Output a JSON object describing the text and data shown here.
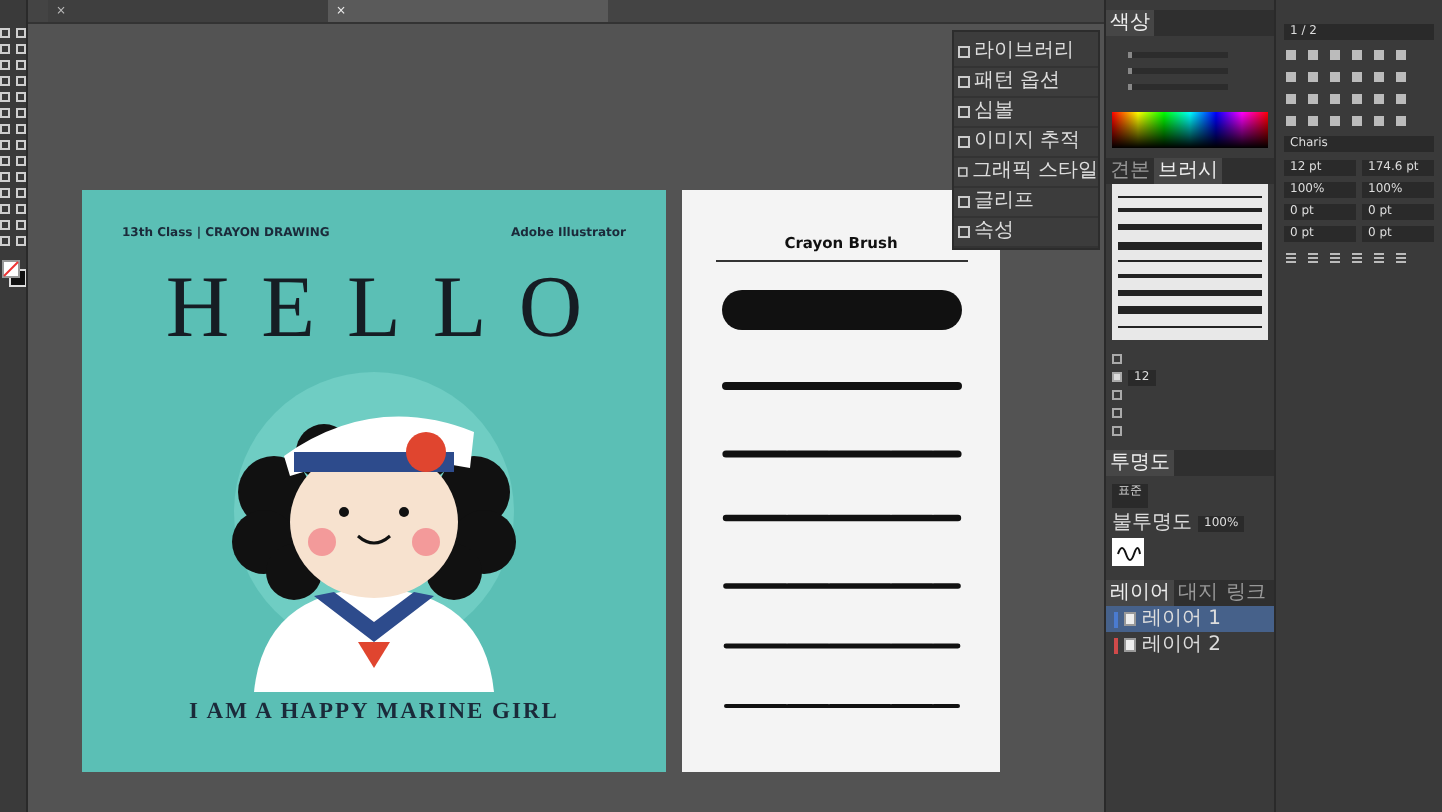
{
  "tabs": [
    {
      "close": "×",
      "selected": false
    },
    {
      "close": "×",
      "selected": true
    }
  ],
  "quick_panel": {
    "items": [
      {
        "label": "라이브러리"
      },
      {
        "label": "패턴 옵션"
      },
      {
        "label": "심볼"
      },
      {
        "label": "이미지 추적"
      },
      {
        "label": "그래픽 스타일"
      },
      {
        "label": "글리프"
      },
      {
        "label": "속성"
      }
    ]
  },
  "poster": {
    "subtitle": "13th Class  |  CRAYON DRAWING",
    "credit": "Adobe Illustrator",
    "title": "HELLO",
    "caption": "I AM A HAPPY MARINE GIRL"
  },
  "brush_sheet": {
    "title": "Crayon Brush"
  },
  "color_panel": {
    "tab": "색상",
    "sliders": [
      {
        "level": 0.0
      },
      {
        "level": 0.0
      },
      {
        "level": 0.0
      }
    ]
  },
  "brushes_panel": {
    "tabs": [
      {
        "label": "견본",
        "selected": false
      },
      {
        "label": "브러시",
        "selected": true
      }
    ]
  },
  "options_panel": {
    "checks": [
      {
        "checked": false
      },
      {
        "checked": true
      },
      {
        "checked": false
      },
      {
        "checked": false
      },
      {
        "checked": false
      }
    ],
    "value": "12"
  },
  "transparency_panel": {
    "title": "투명도",
    "mode": "표준",
    "opacity_label": "불투명도",
    "opacity": "100%"
  },
  "layers_panel": {
    "tabs": [
      {
        "label": "레이어",
        "selected": true
      },
      {
        "label": "대지",
        "selected": false
      },
      {
        "label": "링크",
        "selected": false
      }
    ],
    "layers": [
      {
        "name": "레이어 1",
        "color": "#4a7bd0",
        "selected": true
      },
      {
        "name": "레이어 2",
        "color": "#d04a4a",
        "selected": false
      }
    ]
  },
  "properties_panel": {
    "zoom": "1 / 2",
    "font": "Charis",
    "fields": [
      "12 pt",
      "174.6 pt",
      "100%",
      "100%",
      "0 pt",
      "0 pt",
      "0 pt",
      "0 pt"
    ]
  }
}
